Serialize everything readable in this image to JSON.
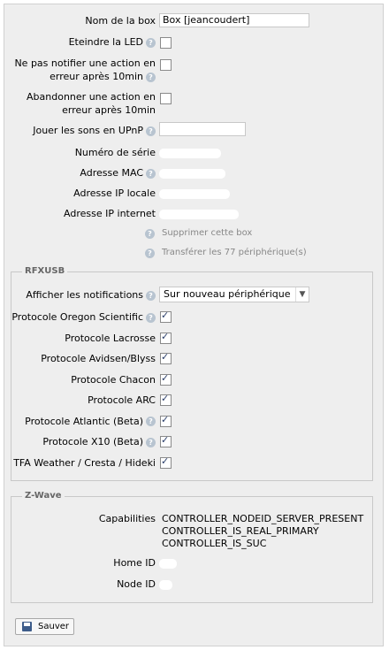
{
  "box": {
    "name_label": "Nom de la box",
    "name_value": "Box [jeancoudert]",
    "led_label": "Eteindre la LED",
    "notify_label": "Ne pas notifier une action en erreur après 10min",
    "abandon_label": "Abandonner une action en erreur après 10min",
    "upnp_label": "Jouer les sons en UPnP",
    "serial_label": "Numéro de série",
    "mac_label": "Adresse MAC",
    "local_ip_label": "Adresse IP locale",
    "internet_ip_label": "Adresse IP internet",
    "delete_link": "Supprimer cette box",
    "transfer_link": "Transférer les 77 périphérique(s)"
  },
  "rfxusb": {
    "legend": "RFXUSB",
    "notifications_label": "Afficher les notifications",
    "notifications_value": "Sur nouveau périphérique",
    "protocols": [
      {
        "label": "Protocole Oregon Scientific",
        "checked": true,
        "help": true
      },
      {
        "label": "Protocole Lacrosse",
        "checked": true,
        "help": false
      },
      {
        "label": "Protocole Avidsen/Blyss",
        "checked": true,
        "help": false
      },
      {
        "label": "Protocole Chacon",
        "checked": true,
        "help": false
      },
      {
        "label": "Protocole ARC",
        "checked": true,
        "help": false
      },
      {
        "label": "Protocole Atlantic (Beta)",
        "checked": true,
        "help": true
      },
      {
        "label": "Protocole X10 (Beta)",
        "checked": true,
        "help": true
      },
      {
        "label": "TFA Weather / Cresta / Hideki",
        "checked": true,
        "help": false
      }
    ]
  },
  "zwave": {
    "legend": "Z-Wave",
    "capabilities_label": "Capabilities",
    "capabilities": [
      "CONTROLLER_NODEID_SERVER_PRESENT",
      "CONTROLLER_IS_REAL_PRIMARY",
      "CONTROLLER_IS_SUC"
    ],
    "home_id_label": "Home ID",
    "node_id_label": "Node ID"
  },
  "save_label": "Sauver",
  "help_glyph": "?",
  "icons": {
    "help": "question-mark-icon",
    "save": "floppy-disk-icon",
    "dropdown": "chevron-down-icon"
  }
}
